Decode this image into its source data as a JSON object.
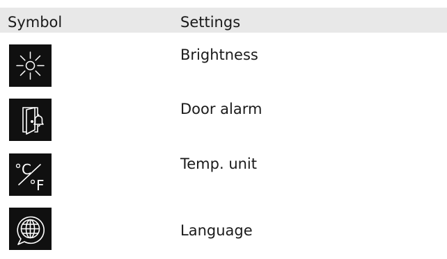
{
  "table": {
    "headers": {
      "symbol": "Symbol",
      "settings": "Settings"
    },
    "rows": [
      {
        "icon": "brightness-icon",
        "label": "Brightness"
      },
      {
        "icon": "door-alarm-icon",
        "label": "Door alarm"
      },
      {
        "icon": "temperature-unit-icon",
        "label": "Temp. unit",
        "icon_text_top": "°C",
        "icon_text_bottom": "°F"
      },
      {
        "icon": "language-icon",
        "label": "Language"
      }
    ]
  },
  "colors": {
    "header_background": "#e8e8e8",
    "icon_background": "#101010",
    "icon_foreground": "#ffffff",
    "text": "#1a1a1a"
  }
}
